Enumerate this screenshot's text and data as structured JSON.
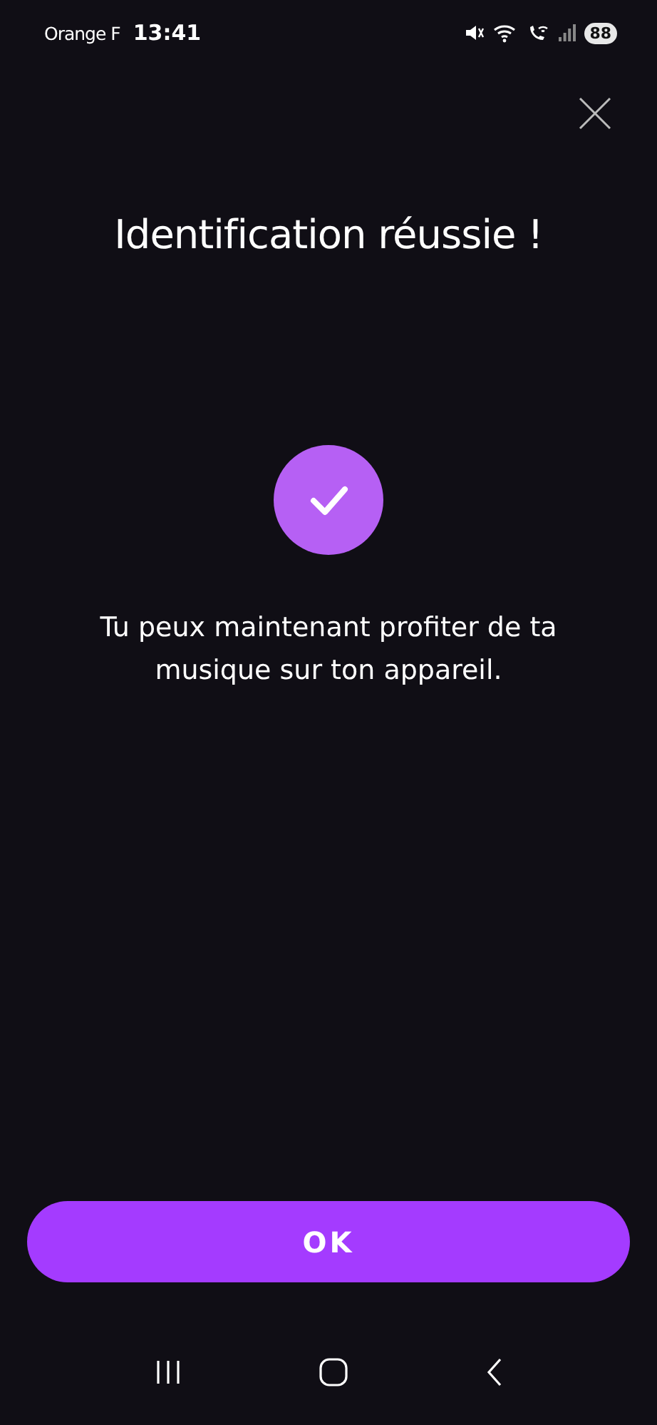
{
  "status_bar": {
    "carrier": "Orange F",
    "time": "13:41",
    "battery": "88"
  },
  "title": "Identification réussie !",
  "message": "Tu peux maintenant profiter de ta musique sur ton appareil.",
  "button": "OK"
}
